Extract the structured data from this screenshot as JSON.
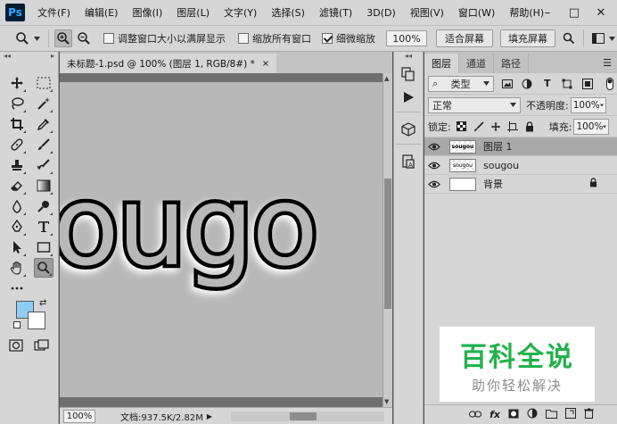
{
  "app": {
    "logo": "Ps"
  },
  "menubar": {
    "items": [
      "文件(F)",
      "编辑(E)",
      "图像(I)",
      "图层(L)",
      "文字(Y)",
      "选择(S)",
      "滤镜(T)",
      "3D(D)",
      "视图(V)",
      "窗口(W)",
      "帮助(H)"
    ],
    "window_controls": [
      "–",
      "□",
      "✕"
    ]
  },
  "options": {
    "tool_icon": "zoom-tool-icon",
    "resize_windows": {
      "label": "调整窗口大小以满屏显示",
      "checked": false
    },
    "zoom_all": {
      "label": "缩放所有窗口",
      "checked": false
    },
    "scrubby_zoom": {
      "label": "细微缩放",
      "checked": true
    },
    "zoom_percent": "100%",
    "fit_screen": "适合屏幕",
    "fill_screen": "填充屏幕"
  },
  "document": {
    "tab_title": "未标题-1.psd @ 100% (图层 1, RGB/8#) *",
    "tab_close": "×",
    "canvas_text": "ougo",
    "status_zoom": "100%",
    "status_doc": "文档:937.5K/2.82M"
  },
  "layers_panel": {
    "tabs": [
      "图层",
      "通道",
      "路径"
    ],
    "filter_label": "类型",
    "blend_mode": "正常",
    "opacity_label": "不透明度:",
    "opacity_value": "100%",
    "lock_label": "锁定:",
    "fill_label": "填充:",
    "fill_value": "100%",
    "layers": [
      {
        "name": "图层 1",
        "thumb_text": "sougou",
        "selected": true,
        "locked": false
      },
      {
        "name": "sougou",
        "thumb_text": "sougou",
        "selected": false,
        "locked": false
      },
      {
        "name": "背景",
        "thumb_text": "",
        "selected": false,
        "locked": true
      }
    ],
    "footer_fx": "fx"
  },
  "watermark": {
    "title": "百科全说",
    "subtitle": "助你轻松解决"
  },
  "colors": {
    "foreground": "#8fcdf4",
    "background": "#ffffff",
    "watermark_green": "#22b24c"
  }
}
